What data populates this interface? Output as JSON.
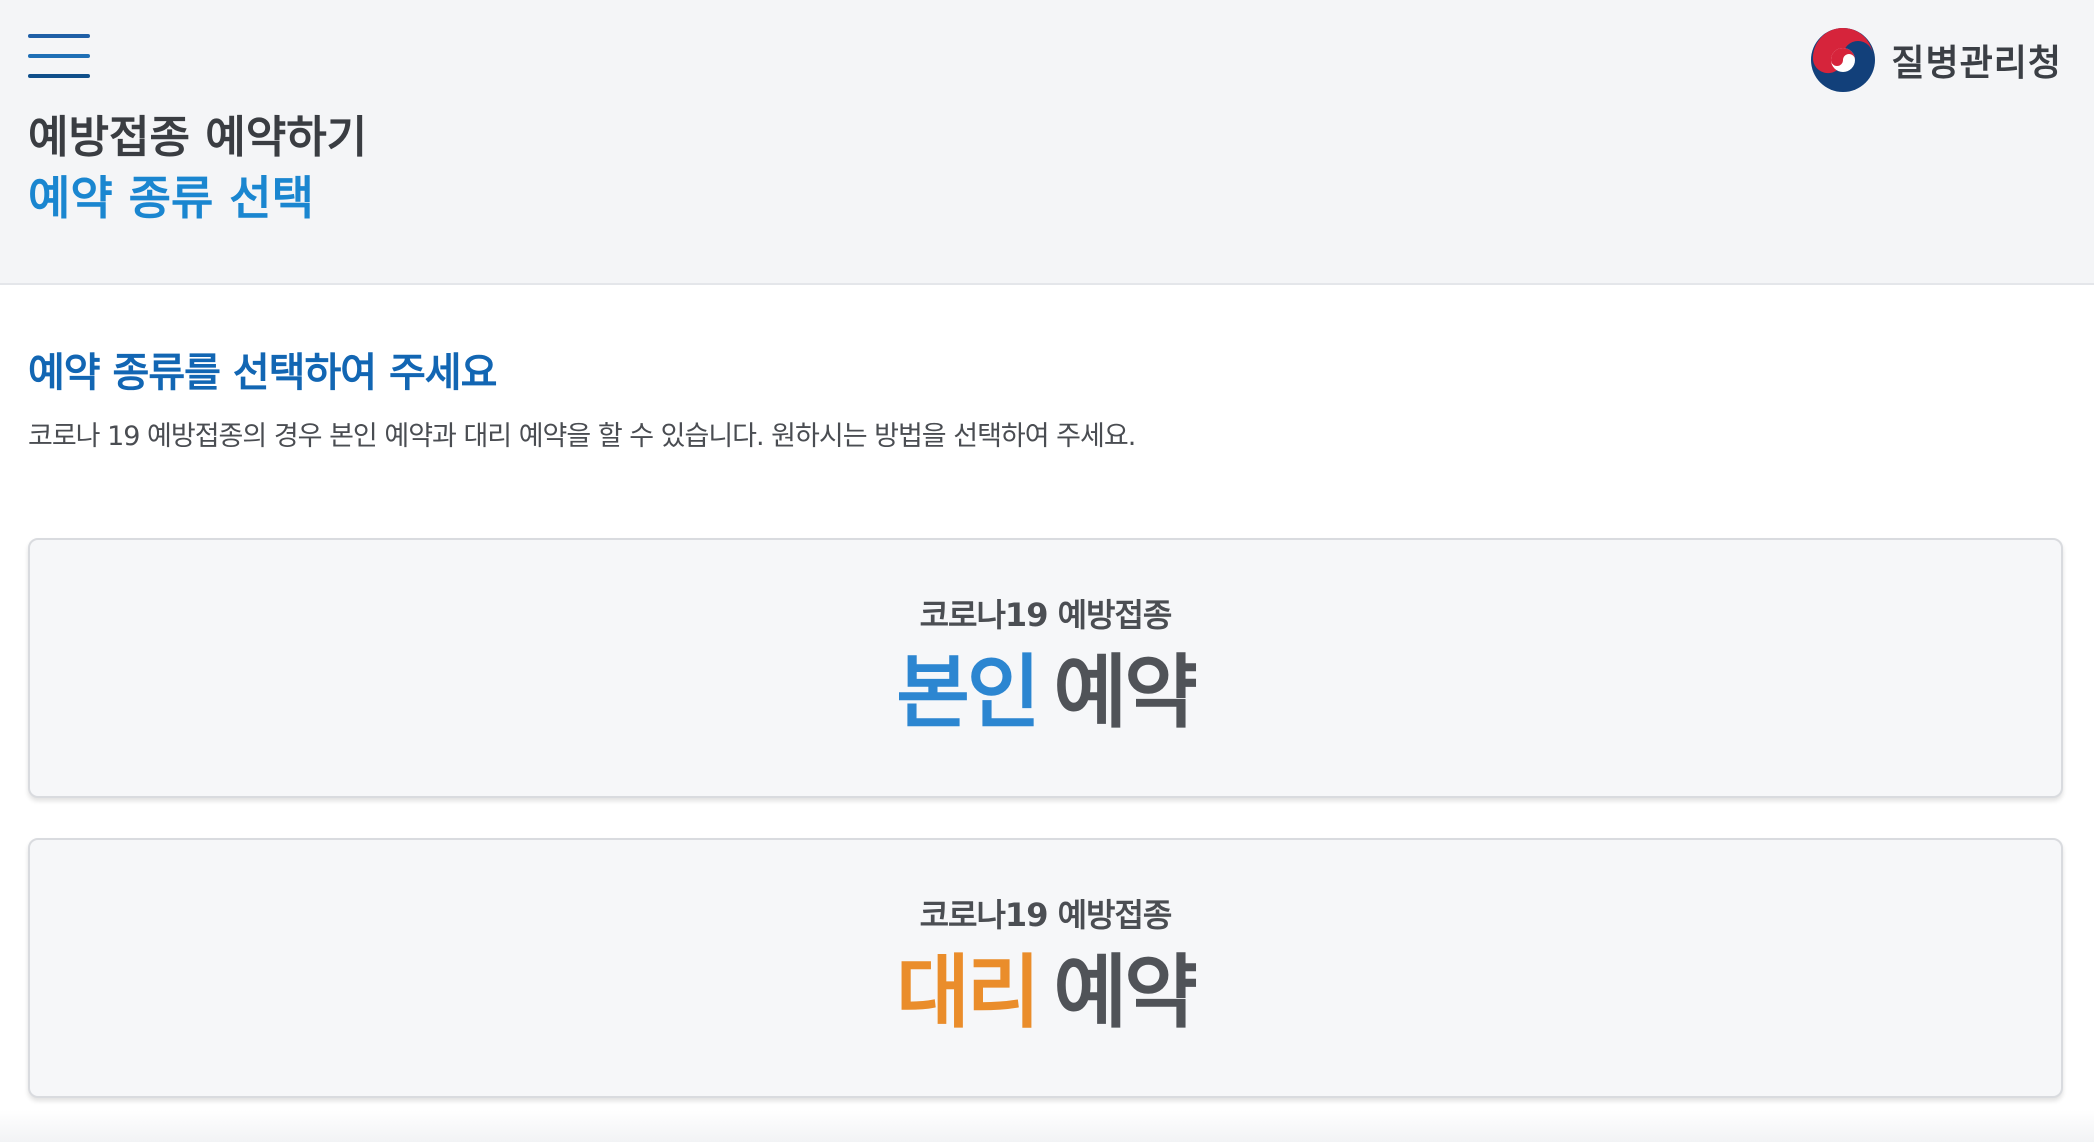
{
  "header": {
    "agency_name": "질병관리청",
    "page_subtitle": "예방접종 예약하기",
    "page_title": "예약 종류 선택"
  },
  "content": {
    "heading": "예약 종류를 선택하여 주세요",
    "description": "코로나 19 예방접종의 경우 본인 예약과 대리 예약을 할 수 있습니다. 원하시는 방법을 선택하여 주세요."
  },
  "options": [
    {
      "subtitle": "코로나19 예방접종",
      "accent": "본인",
      "label": "예약",
      "accent_color": "#2c86d1"
    },
    {
      "subtitle": "코로나19 예방접종",
      "accent": "대리",
      "label": "예약",
      "accent_color": "#ea8d2b"
    }
  ],
  "icons": {
    "menu": "hamburger-menu-icon",
    "logo": "taegeuk-emblem-icon"
  },
  "colors": {
    "primary_blue": "#1a86d0",
    "heading_blue": "#1266b3",
    "orange": "#ea8d2b"
  }
}
